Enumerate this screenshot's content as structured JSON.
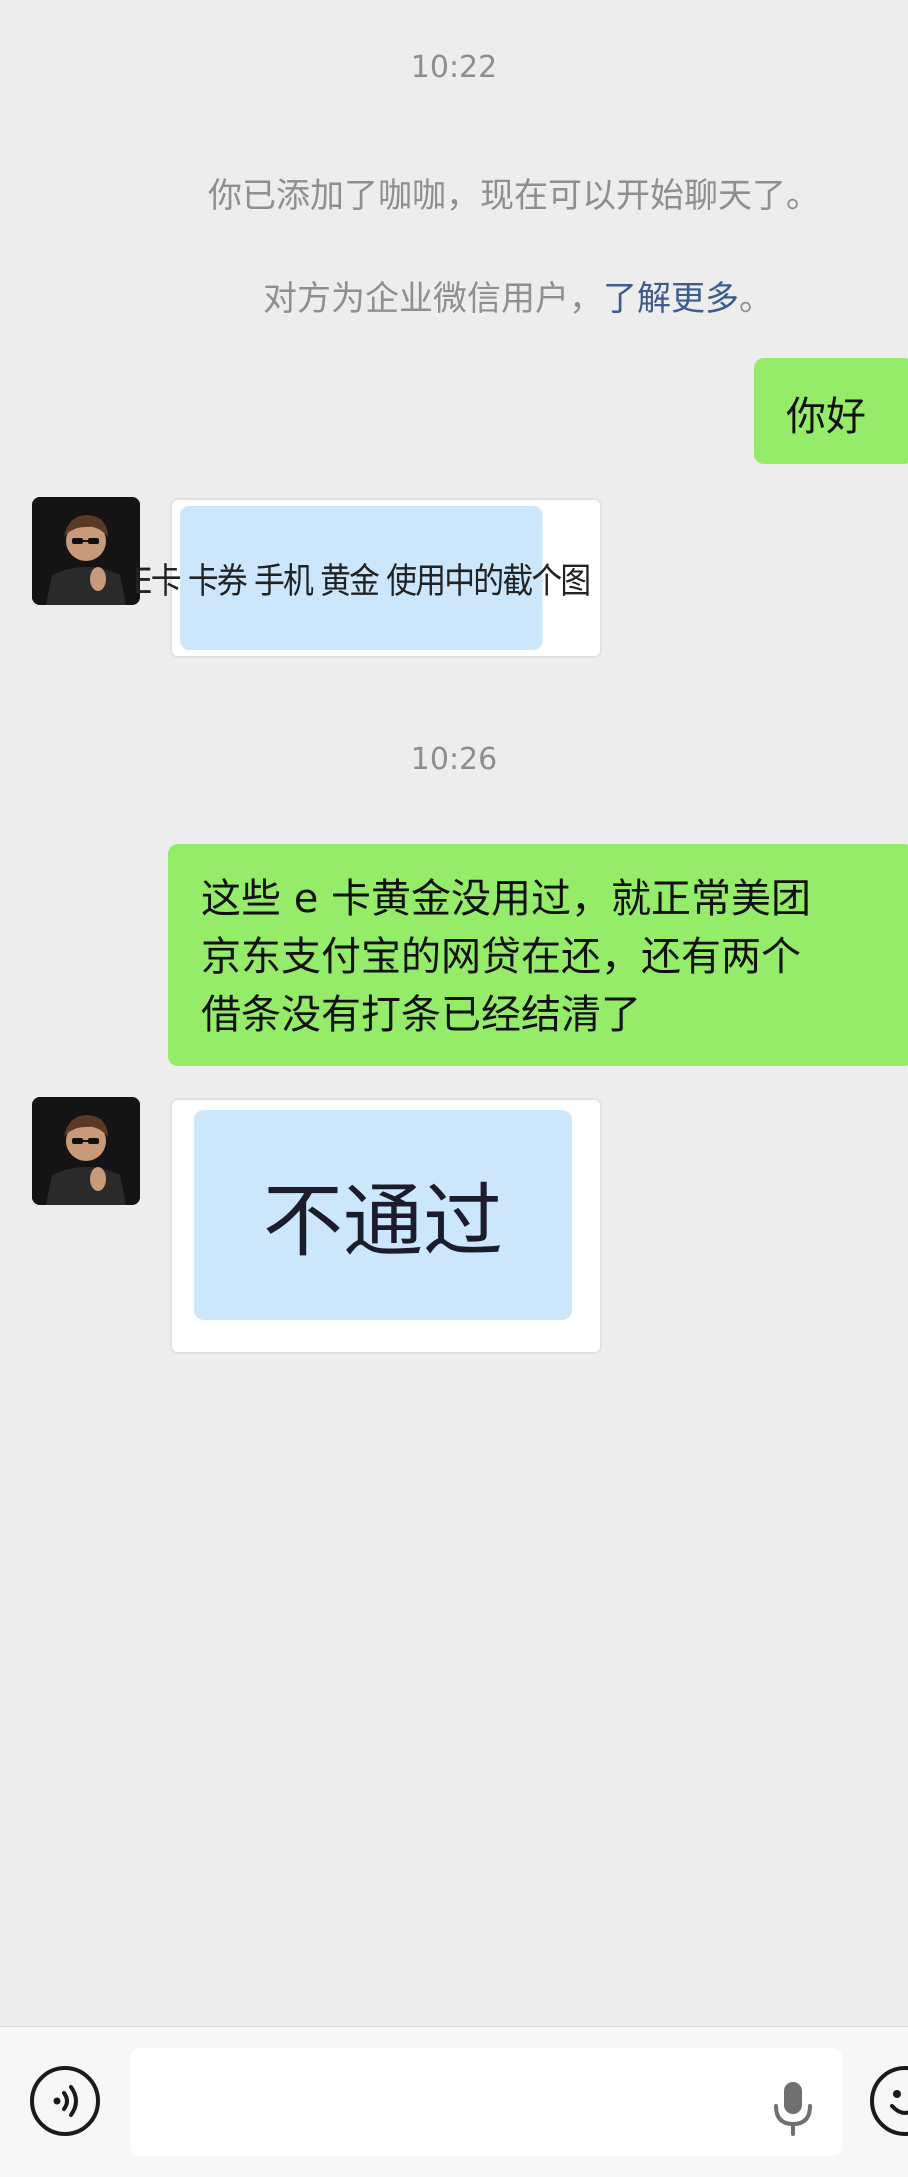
{
  "chat": {
    "time1": "10:22",
    "system_added": "你已添加了咖咖，现在可以开始聊天了。",
    "system_enterprise_prefix": "对方为企业微信用户，",
    "system_enterprise_link": "了解更多",
    "system_enterprise_suffix": "。",
    "msg_hello": "你好",
    "sticker1_text": "E卡 卡券 手机 黄金 使用中的截个图",
    "time2": "10:26",
    "msg_long_line1": "这些 e 卡黄金没用过，就正常美团",
    "msg_long_line2": "京东支付宝的网贷在还，还有两个",
    "msg_long_line3": "借条没有打条已经结清了",
    "sticker2_text": "不通过"
  },
  "input_bar": {
    "voice_icon": "voice-toggle-icon",
    "mic_icon": "microphone-icon",
    "emoji_icon": "emoji-icon"
  },
  "colors": {
    "background": "#ededed",
    "bubble_green": "#95ec69",
    "link": "#3d5b8f",
    "sticker_blue": "#cce7fb"
  }
}
